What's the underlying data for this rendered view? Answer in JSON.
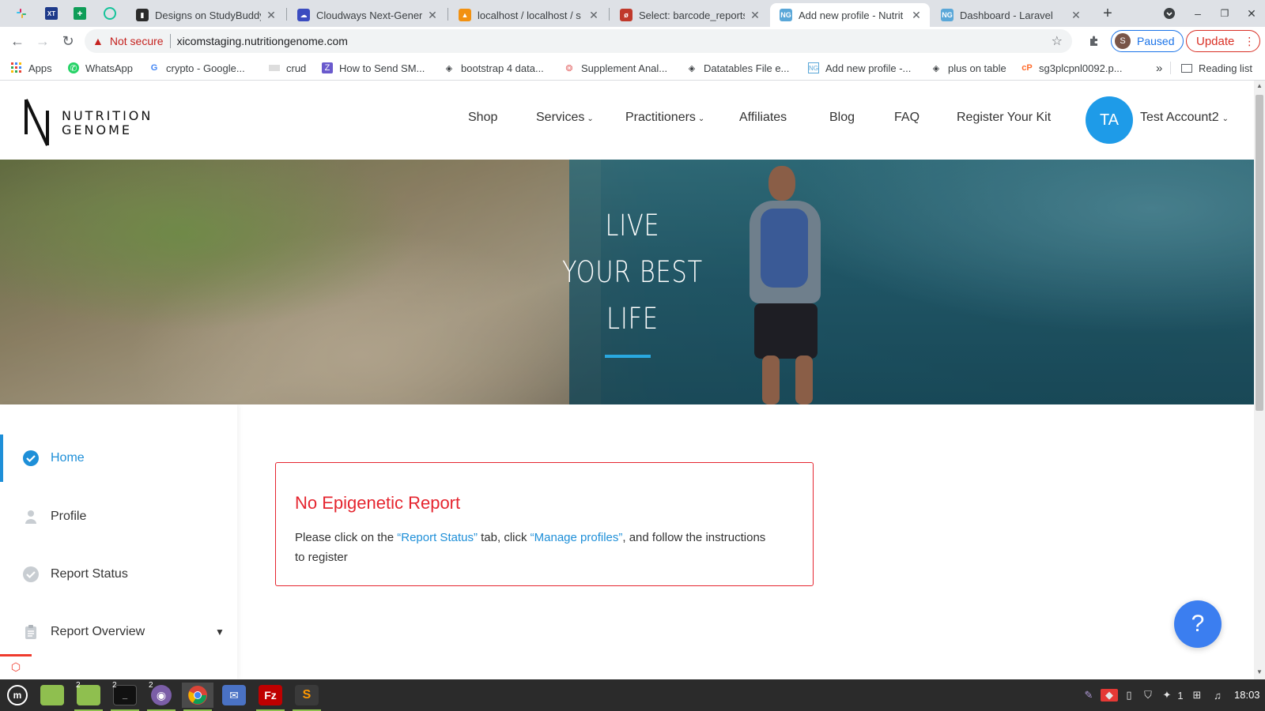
{
  "browser": {
    "tabs": [
      {
        "title": "Designs on StudyBuddy",
        "favicon_color": "#2b2b2b"
      },
      {
        "title": "Cloudways Next-Genera",
        "favicon_color": "#3b4cc0"
      },
      {
        "title": "localhost / localhost / s",
        "favicon_color": "#f29111"
      },
      {
        "title": "Select: barcode_reports",
        "favicon_color": "#c0392b"
      },
      {
        "title": "Add new profile - Nutrit",
        "favicon_color": "#5aa7d8"
      },
      {
        "title": "Dashboard - Laravel",
        "favicon_color": "#5aa7d8"
      }
    ],
    "pinned_tabs": [
      "slack-icon",
      "xd-icon",
      "sheets-icon",
      "grammarly-icon"
    ],
    "address": {
      "security_label": "Not secure",
      "url": "xicomstaging.nutritiongenome.com"
    },
    "profile": {
      "initial": "S",
      "label": "Paused"
    },
    "update_label": "Update",
    "bookmarks": [
      {
        "label": "Apps",
        "icon": "apps-grid-icon"
      },
      {
        "label": "WhatsApp",
        "icon": "whatsapp-icon"
      },
      {
        "label": "crypto - Google...",
        "icon": "google-icon"
      },
      {
        "label": "crud",
        "icon": "page-icon"
      },
      {
        "label": "How to Send SM...",
        "icon": "zendesk-icon"
      },
      {
        "label": "bootstrap 4 data...",
        "icon": "codepen-icon"
      },
      {
        "label": "Supplement Anal...",
        "icon": "supplement-icon"
      },
      {
        "label": "Datatables File e...",
        "icon": "codepen-icon"
      },
      {
        "label": "Add new profile -...",
        "icon": "ng-icon"
      },
      {
        "label": "plus on table",
        "icon": "codepen-icon"
      },
      {
        "label": "sg3plcpnl0092.p...",
        "icon": "cpanel-icon"
      }
    ],
    "bookmarks_overflow": "»",
    "reading_list_label": "Reading list"
  },
  "site": {
    "logo_lines": [
      "NUTRITION",
      "GENOME"
    ],
    "nav": [
      {
        "label": "Shop",
        "dropdown": false
      },
      {
        "label": "Services",
        "dropdown": true
      },
      {
        "label": "Practitioners",
        "dropdown": true
      },
      {
        "label": "Affiliates",
        "dropdown": false
      },
      {
        "label": "Blog",
        "dropdown": false
      },
      {
        "label": "FAQ",
        "dropdown": false
      },
      {
        "label": "Register Your Kit",
        "dropdown": false
      }
    ],
    "user": {
      "initials": "TA",
      "name": "Test Account2"
    },
    "hero_lines": [
      "LIVE",
      "YOUR BEST",
      "LIFE"
    ],
    "accent_color": "#1e8fd8"
  },
  "sidebar": {
    "items": [
      {
        "label": "Home",
        "icon": "check-circle-icon",
        "active": true
      },
      {
        "label": "Profile",
        "icon": "user-icon",
        "active": false
      },
      {
        "label": "Report Status",
        "icon": "check-circle-icon",
        "active": false
      },
      {
        "label": "Report Overview",
        "icon": "clipboard-icon",
        "active": false,
        "expandable": true
      }
    ]
  },
  "alert": {
    "title": "No Epigenetic Report",
    "text_before": "Please click on the ",
    "link1": "“Report Status”",
    "text_middle": " tab, click ",
    "link2": "“Manage profiles”",
    "text_after": ", and follow the instructions to register",
    "border_color": "#e5252f"
  },
  "help_button": {
    "label": "?"
  },
  "taskbar": {
    "apps": [
      {
        "name": "mint-menu",
        "badge": ""
      },
      {
        "name": "files",
        "badge": ""
      },
      {
        "name": "files",
        "badge": "2"
      },
      {
        "name": "terminal",
        "badge": "2"
      },
      {
        "name": "pidgin",
        "badge": "2"
      },
      {
        "name": "chrome",
        "badge": ""
      },
      {
        "name": "mail",
        "badge": ""
      },
      {
        "name": "filezilla",
        "badge": ""
      },
      {
        "name": "sublime-text",
        "badge": ""
      }
    ],
    "tray_workspace": "1",
    "clock": "18:03"
  }
}
